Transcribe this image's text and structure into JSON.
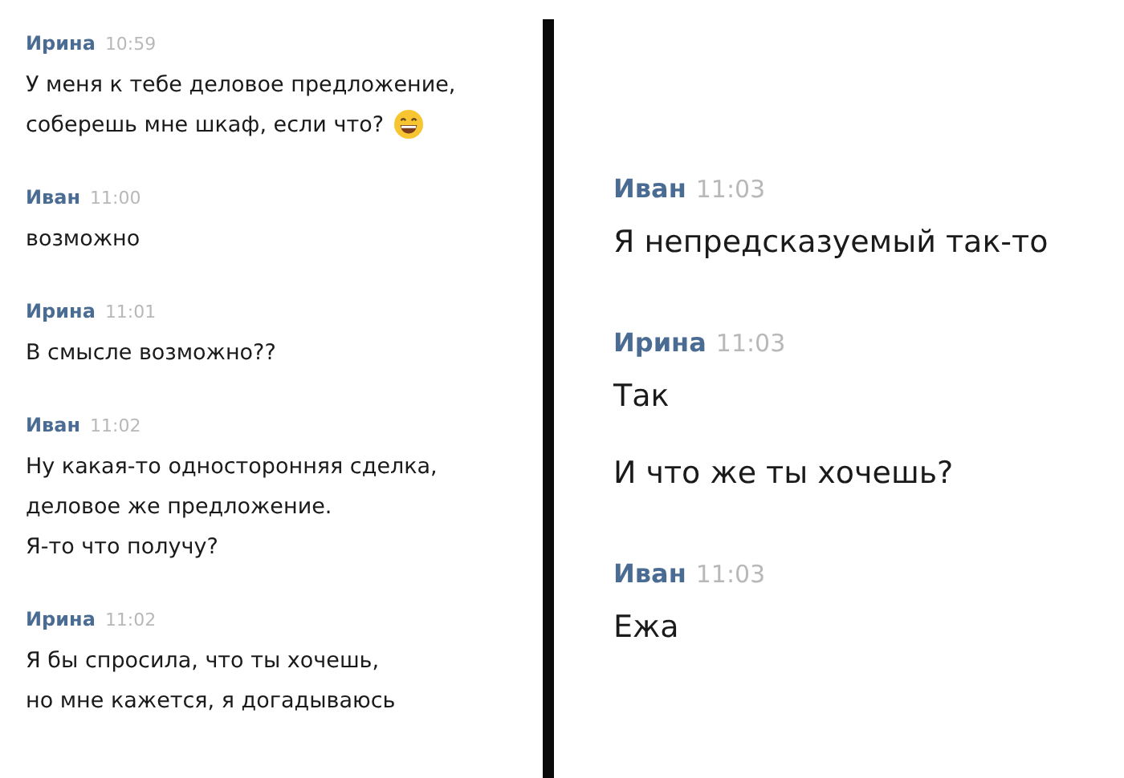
{
  "panels": [
    {
      "kind": "small",
      "groups": [
        {
          "author": "Ирина",
          "time": "10:59",
          "messages": [
            {
              "kind": "emoji",
              "lines": [
                "У меня к тебе деловое предложение,",
                "соберешь мне шкаф, если что?"
              ]
            }
          ]
        },
        {
          "author": "Иван",
          "time": "11:00",
          "messages": [
            {
              "kind": "text",
              "lines": [
                "возможно"
              ]
            }
          ]
        },
        {
          "author": "Ирина",
          "time": "11:01",
          "messages": [
            {
              "kind": "text",
              "lines": [
                "В смысле возможно??"
              ]
            }
          ]
        },
        {
          "author": "Иван",
          "time": "11:02",
          "messages": [
            {
              "kind": "text",
              "lines": [
                "Ну какая-то односторонняя сделка,",
                "деловое же предложение.",
                "Я-то что получу?"
              ]
            }
          ]
        },
        {
          "author": "Ирина",
          "time": "11:02",
          "messages": [
            {
              "kind": "text",
              "lines": [
                "Я бы спросила, что ты хочешь,",
                "но мне кажется, я догадываюсь"
              ]
            }
          ]
        }
      ]
    },
    {
      "kind": "large",
      "groups": [
        {
          "author": "Иван",
          "time": "11:03",
          "messages": [
            {
              "kind": "text",
              "lines": [
                "Я непредсказуемый так-то"
              ]
            }
          ]
        },
        {
          "author": "Ирина",
          "time": "11:03",
          "messages": [
            {
              "kind": "text",
              "lines": [
                "Так"
              ]
            },
            {
              "kind": "text",
              "lines": [
                "И что же ты хочешь?"
              ]
            }
          ]
        },
        {
          "author": "Иван",
          "time": "11:03",
          "messages": [
            {
              "kind": "text",
              "lines": [
                "Ежа"
              ]
            }
          ]
        }
      ]
    }
  ]
}
